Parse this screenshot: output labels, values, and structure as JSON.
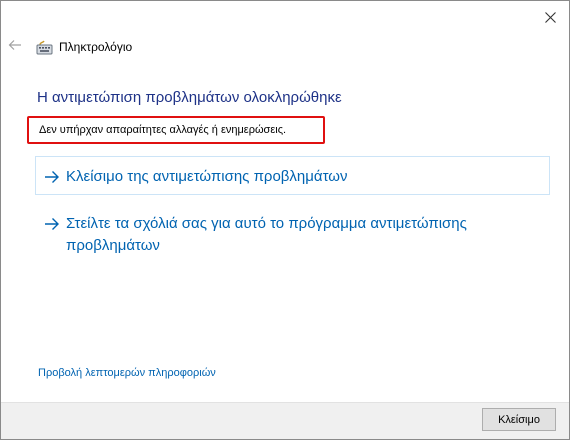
{
  "window": {
    "title": "Πληκτρολόγιο",
    "close_icon": "close-icon",
    "back_icon": "back-arrow-icon",
    "app_icon": "keyboard-icon"
  },
  "main": {
    "heading": "Η αντιμετώπιση προβλημάτων ολοκληρώθηκε",
    "message": "Δεν υπήρχαν απαραίτητες αλλαγές ή ενημερώσεις.",
    "options": [
      {
        "label": "Κλείσιμο της αντιμετώπισης προβλημάτων",
        "icon": "right-arrow-icon"
      },
      {
        "label": "Στείλτε τα σχόλιά σας για αυτό το πρόγραμμα αντιμετώπισης προβλημάτων",
        "icon": "right-arrow-icon"
      }
    ],
    "details_link": "Προβολή λεπτομερών πληροφοριών"
  },
  "footer": {
    "close_button": "Κλείσιμο"
  },
  "colors": {
    "heading": "#1e3287",
    "link": "#0063b1",
    "highlight_border": "#e01010",
    "footer_bg": "#f0f0f0"
  }
}
